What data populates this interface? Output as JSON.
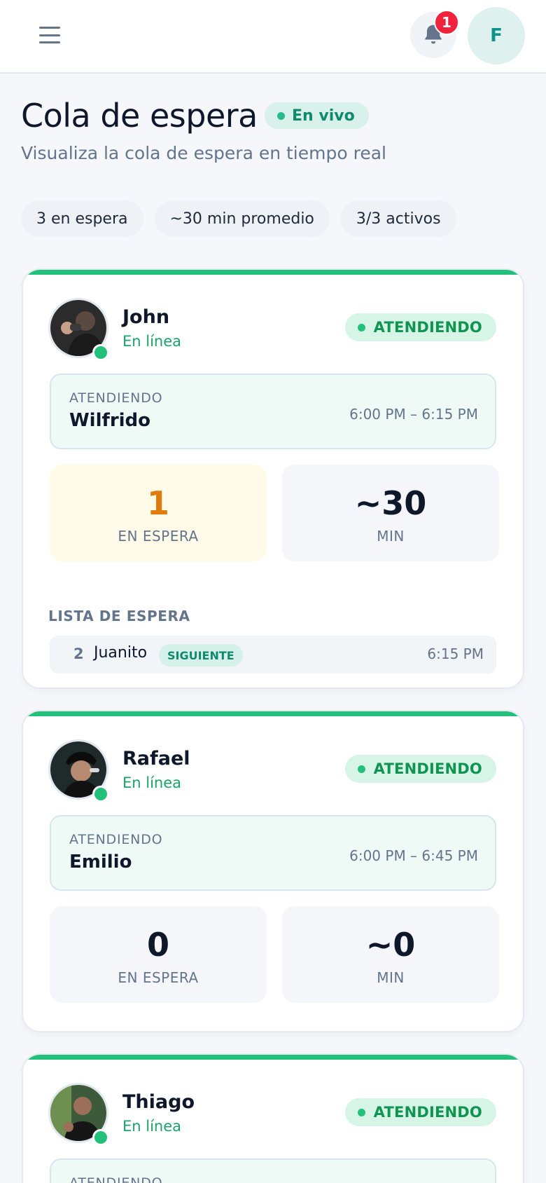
{
  "header": {
    "notification_count": "1",
    "user_initial": "F"
  },
  "page": {
    "title": "Cola de espera",
    "live_label": "En vivo",
    "subtitle": "Visualiza la cola de espera en tiempo real"
  },
  "stats": [
    "3 en espera",
    "~30 min promedio",
    "3/3 activos"
  ],
  "barbers": [
    {
      "name": "John",
      "status": "En línea",
      "state_label": "ATENDIENDO",
      "serving_label": "ATENDIENDO",
      "serving_client": "Wilfrido",
      "serving_time": "6:00 PM – 6:15 PM",
      "waiting_count": "1",
      "waiting_label": "EN ESPERA",
      "wait_minutes": "~30",
      "wait_minutes_label": "MIN",
      "waitlist_title": "LISTA DE ESPERA",
      "waitlist": [
        {
          "position": "2",
          "name": "Juanito",
          "badge": "SIGUIENTE",
          "time": "6:15 PM"
        }
      ]
    },
    {
      "name": "Rafael",
      "status": "En línea",
      "state_label": "ATENDIENDO",
      "serving_label": "ATENDIENDO",
      "serving_client": "Emilio",
      "serving_time": "6:00 PM – 6:45 PM",
      "waiting_count": "0",
      "waiting_label": "EN ESPERA",
      "wait_minutes": "~0",
      "wait_minutes_label": "MIN"
    },
    {
      "name": "Thiago",
      "status": "En línea",
      "state_label": "ATENDIENDO",
      "serving_label": "ATENDIENDO"
    }
  ],
  "colors": {
    "accent_green": "#22c07a",
    "teal": "#0d9488",
    "warning_orange": "#e07b0c",
    "notification_red": "#ef233c"
  }
}
